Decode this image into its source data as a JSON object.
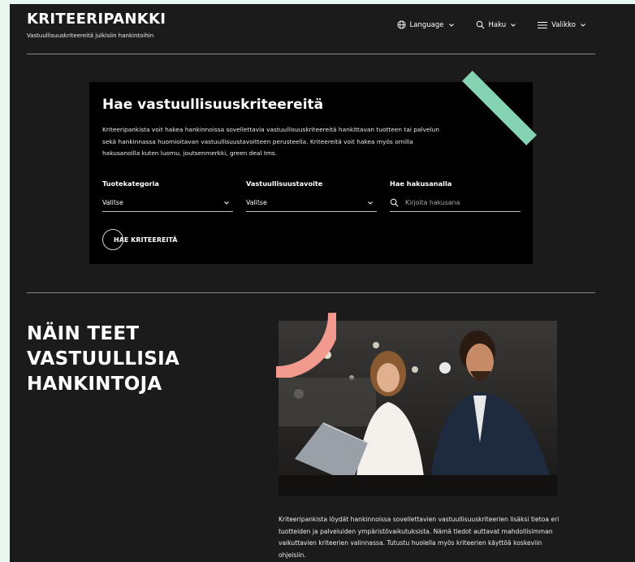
{
  "header": {
    "brand_title": "KRITEERIPANKKI",
    "brand_subtitle": "Vastuullisuuskriteereitä julkisiin hankintoihin",
    "nav": {
      "language": "Language",
      "search": "Haku",
      "menu": "Valikko"
    }
  },
  "search_panel": {
    "title": "Hae vastuullisuuskriteereitä",
    "description": "Kriteeripankista voit hakea hankinnoissa sovellettavia vastuullisuuskriteereitä hankittavan tuotteen tai palvelun sekä hankinnassa huomioitavan vastuullisuustavoitteen perusteella. Kriteereitä voit hakea myös omilla hakusanoilla kuten luomu, joutsenmerkki, green deal tms.",
    "category": {
      "label": "Tuotekategoria",
      "value": "Valitse"
    },
    "goal": {
      "label": "Vastuullisuustavoite",
      "value": "Valitse"
    },
    "keyword": {
      "label": "Hae hakusanalla",
      "placeholder": "Kirjoita hakusana"
    },
    "button_label": "HAE KRITEEREITÄ"
  },
  "section": {
    "heading_line1": "NÄIN TEET",
    "heading_line2": "VASTUULLISIA",
    "heading_line3": "HANKINTOJA",
    "body": "Kriteeripankista löydät hankinnoissa sovellettavien vastuullisuuskriteerien lisäksi tietoa eri tuotteiden ja palveluiden ympäristövaikutuksista. Nämä tiedot auttavat mahdollisimman vaikuttavien kriteerien valinnassa. Tutustu huolella myös kriteerien käyttöä koskeviin ohjeisiin."
  },
  "colors": {
    "accent_green": "#86d3b3",
    "accent_coral": "#f39a8e",
    "background": "#1b1b1b",
    "panel": "#000000"
  },
  "icons": [
    "globe-icon",
    "search-icon",
    "menu-icon",
    "chevron-down-icon"
  ]
}
